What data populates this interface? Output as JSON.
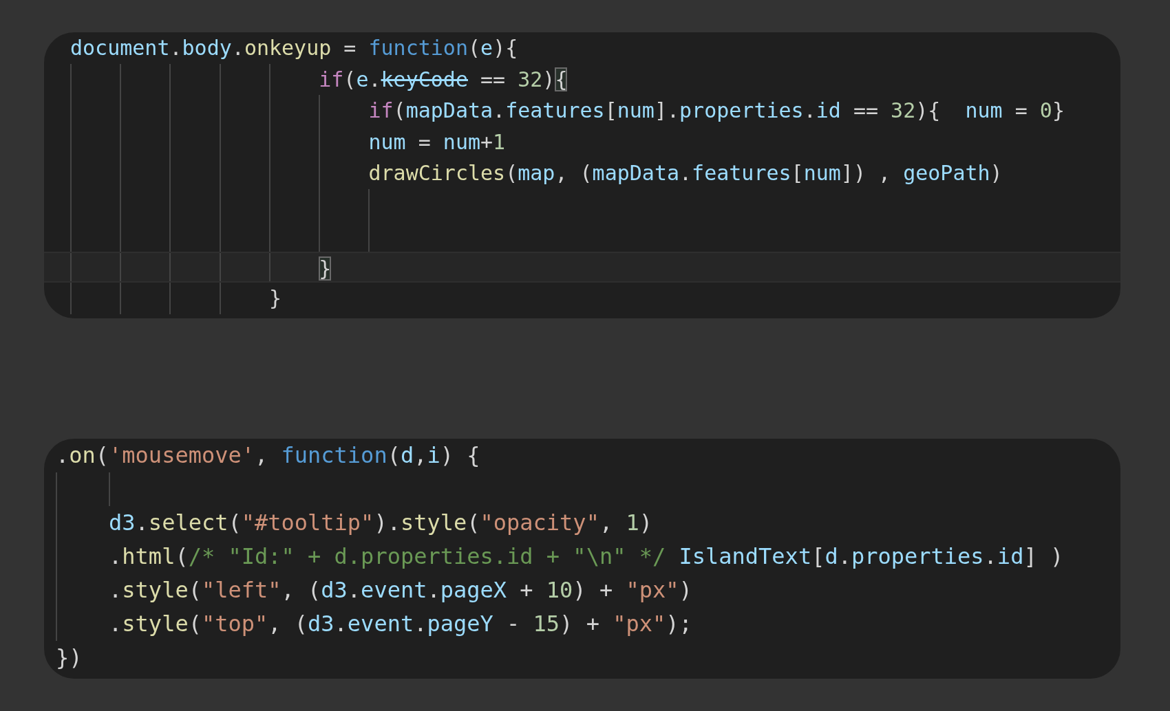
{
  "snippets": [
    {
      "lines": [
        {
          "current": false,
          "tokens": [
            {
              "kind": "var",
              "text": "document"
            },
            {
              "kind": "plain",
              "text": "."
            },
            {
              "kind": "var",
              "text": "body"
            },
            {
              "kind": "plain",
              "text": "."
            },
            {
              "kind": "func",
              "text": "onkeyup"
            },
            {
              "kind": "plain",
              "text": " = "
            },
            {
              "kind": "storage",
              "text": "function"
            },
            {
              "kind": "plain",
              "text": "("
            },
            {
              "kind": "var",
              "text": "e"
            },
            {
              "kind": "plain",
              "text": "){"
            }
          ]
        },
        {
          "current": false,
          "tokens": [
            {
              "kind": "control",
              "text": "                    if"
            },
            {
              "kind": "plain",
              "text": "("
            },
            {
              "kind": "var",
              "text": "e"
            },
            {
              "kind": "plain",
              "text": "."
            },
            {
              "kind": "deprecated",
              "text": "keyCode"
            },
            {
              "kind": "plain",
              "text": " == "
            },
            {
              "kind": "number",
              "text": "32"
            },
            {
              "kind": "plain",
              "text": ")"
            },
            {
              "kind": "matched_bracket",
              "text": "{"
            }
          ]
        },
        {
          "current": false,
          "tokens": [
            {
              "kind": "control",
              "text": "                        if"
            },
            {
              "kind": "plain",
              "text": "("
            },
            {
              "kind": "var",
              "text": "mapData"
            },
            {
              "kind": "plain",
              "text": "."
            },
            {
              "kind": "var",
              "text": "features"
            },
            {
              "kind": "plain",
              "text": "["
            },
            {
              "kind": "var",
              "text": "num"
            },
            {
              "kind": "plain",
              "text": "]."
            },
            {
              "kind": "var",
              "text": "properties"
            },
            {
              "kind": "plain",
              "text": "."
            },
            {
              "kind": "var",
              "text": "id"
            },
            {
              "kind": "plain",
              "text": " == "
            },
            {
              "kind": "number",
              "text": "32"
            },
            {
              "kind": "plain",
              "text": "){  "
            },
            {
              "kind": "var",
              "text": "num"
            },
            {
              "kind": "plain",
              "text": " = "
            },
            {
              "kind": "number",
              "text": "0"
            },
            {
              "kind": "plain",
              "text": "}"
            }
          ]
        },
        {
          "current": false,
          "tokens": [
            {
              "kind": "var",
              "text": "                        num"
            },
            {
              "kind": "plain",
              "text": " = "
            },
            {
              "kind": "var",
              "text": "num"
            },
            {
              "kind": "plain",
              "text": "+"
            },
            {
              "kind": "number",
              "text": "1"
            }
          ]
        },
        {
          "current": false,
          "tokens": [
            {
              "kind": "func",
              "text": "                        drawCircles"
            },
            {
              "kind": "plain",
              "text": "("
            },
            {
              "kind": "var",
              "text": "map"
            },
            {
              "kind": "plain",
              "text": ", ("
            },
            {
              "kind": "var",
              "text": "mapData"
            },
            {
              "kind": "plain",
              "text": "."
            },
            {
              "kind": "var",
              "text": "features"
            },
            {
              "kind": "plain",
              "text": "["
            },
            {
              "kind": "var",
              "text": "num"
            },
            {
              "kind": "plain",
              "text": "]) , "
            },
            {
              "kind": "var",
              "text": "geoPath"
            },
            {
              "kind": "plain",
              "text": ")"
            }
          ]
        },
        {
          "current": false
        },
        {
          "current": false
        },
        {
          "current": true,
          "tokens": [
            {
              "kind": "matched_bracket",
              "text": "                    }"
            }
          ]
        },
        {
          "current": false,
          "tokens": [
            {
              "kind": "plain",
              "text": "                }"
            }
          ]
        }
      ]
    },
    {
      "lines": [
        {
          "current": false,
          "tokens": [
            {
              "kind": "plain",
              "text": "."
            },
            {
              "kind": "func",
              "text": "on"
            },
            {
              "kind": "plain",
              "text": "("
            },
            {
              "kind": "string",
              "text": "'mousemove'"
            },
            {
              "kind": "plain",
              "text": ", "
            },
            {
              "kind": "storage",
              "text": "function"
            },
            {
              "kind": "plain",
              "text": "("
            },
            {
              "kind": "var",
              "text": "d"
            },
            {
              "kind": "plain",
              "text": ","
            },
            {
              "kind": "var",
              "text": "i"
            },
            {
              "kind": "plain",
              "text": ") {"
            }
          ]
        },
        {
          "current": false
        },
        {
          "current": false,
          "tokens": [
            {
              "kind": "var",
              "text": "    d3"
            },
            {
              "kind": "plain",
              "text": "."
            },
            {
              "kind": "func",
              "text": "select"
            },
            {
              "kind": "plain",
              "text": "("
            },
            {
              "kind": "string",
              "text": "\"#tooltip\""
            },
            {
              "kind": "plain",
              "text": ")."
            },
            {
              "kind": "func",
              "text": "style"
            },
            {
              "kind": "plain",
              "text": "("
            },
            {
              "kind": "string",
              "text": "\"opacity\""
            },
            {
              "kind": "plain",
              "text": ", "
            },
            {
              "kind": "number",
              "text": "1"
            },
            {
              "kind": "plain",
              "text": ")"
            }
          ]
        },
        {
          "current": false,
          "tokens": [
            {
              "kind": "plain",
              "text": "    ."
            },
            {
              "kind": "func",
              "text": "html"
            },
            {
              "kind": "plain",
              "text": "("
            },
            {
              "kind": "comment",
              "text": "/* \"Id:\" + d.properties.id + \"\\n\" */"
            },
            {
              "kind": "var",
              "text": " IslandText"
            },
            {
              "kind": "plain",
              "text": "["
            },
            {
              "kind": "var",
              "text": "d"
            },
            {
              "kind": "plain",
              "text": "."
            },
            {
              "kind": "var",
              "text": "properties"
            },
            {
              "kind": "plain",
              "text": "."
            },
            {
              "kind": "var",
              "text": "id"
            },
            {
              "kind": "plain",
              "text": "] )"
            }
          ]
        },
        {
          "current": false,
          "tokens": [
            {
              "kind": "plain",
              "text": "    ."
            },
            {
              "kind": "func",
              "text": "style"
            },
            {
              "kind": "plain",
              "text": "("
            },
            {
              "kind": "string",
              "text": "\"left\""
            },
            {
              "kind": "plain",
              "text": ", ("
            },
            {
              "kind": "var",
              "text": "d3"
            },
            {
              "kind": "plain",
              "text": "."
            },
            {
              "kind": "var",
              "text": "event"
            },
            {
              "kind": "plain",
              "text": "."
            },
            {
              "kind": "var",
              "text": "pageX"
            },
            {
              "kind": "plain",
              "text": " + "
            },
            {
              "kind": "number",
              "text": "10"
            },
            {
              "kind": "plain",
              "text": ") + "
            },
            {
              "kind": "string",
              "text": "\"px\""
            },
            {
              "kind": "plain",
              "text": ")"
            }
          ]
        },
        {
          "current": false,
          "tokens": [
            {
              "kind": "plain",
              "text": "    ."
            },
            {
              "kind": "func",
              "text": "style"
            },
            {
              "kind": "plain",
              "text": "("
            },
            {
              "kind": "string",
              "text": "\"top\""
            },
            {
              "kind": "plain",
              "text": ", ("
            },
            {
              "kind": "var",
              "text": "d3"
            },
            {
              "kind": "plain",
              "text": "."
            },
            {
              "kind": "var",
              "text": "event"
            },
            {
              "kind": "plain",
              "text": "."
            },
            {
              "kind": "var",
              "text": "pageY"
            },
            {
              "kind": "plain",
              "text": " - "
            },
            {
              "kind": "number",
              "text": "15"
            },
            {
              "kind": "plain",
              "text": ") + "
            },
            {
              "kind": "string",
              "text": "\"px\""
            },
            {
              "kind": "plain",
              "text": ");"
            }
          ]
        },
        {
          "current": false,
          "tokens": [
            {
              "kind": "plain",
              "text": "})"
            }
          ]
        }
      ]
    }
  ]
}
